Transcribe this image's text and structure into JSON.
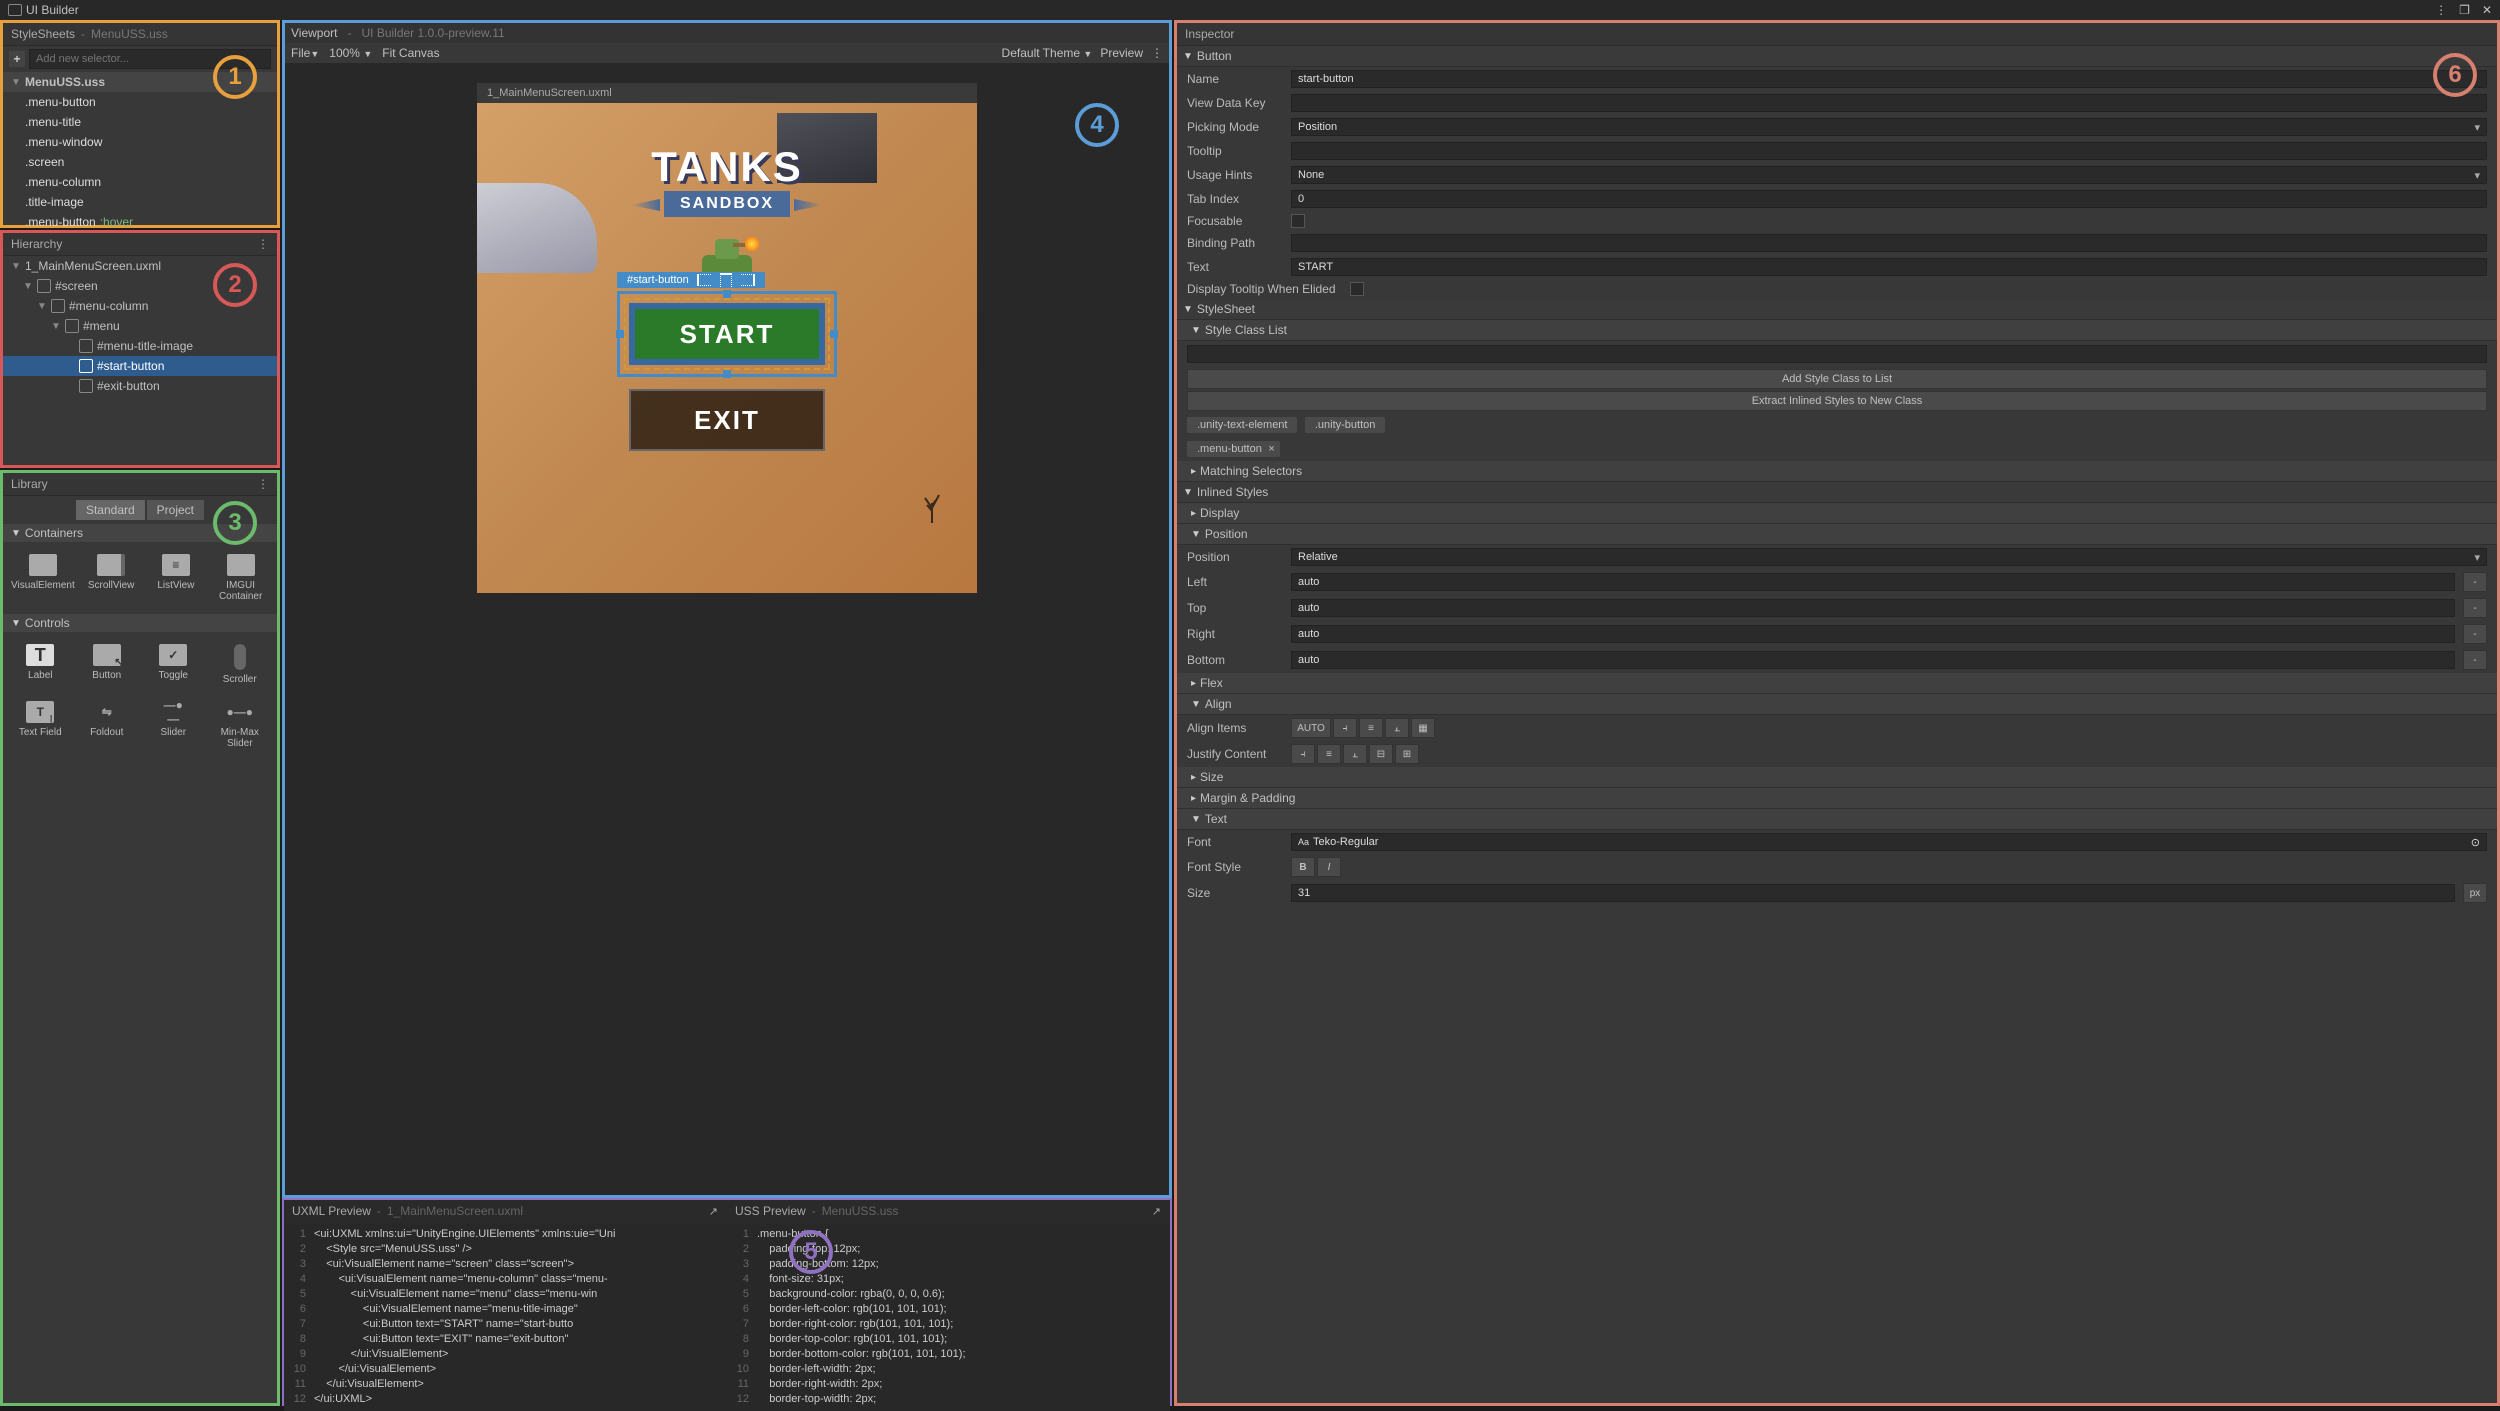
{
  "titlebar": {
    "title": "UI Builder"
  },
  "stylesheets": {
    "header": "StyleSheets",
    "file": "MenuUSS.uss",
    "placeholder": "Add new selector...",
    "tree_root": "MenuUSS.uss",
    "selectors": [
      ".menu-button",
      ".menu-title",
      ".menu-window",
      ".screen",
      ".menu-column",
      ".title-image"
    ],
    "hover_selector": ".menu-button",
    "hover_state": ":hover"
  },
  "hierarchy": {
    "header": "Hierarchy",
    "root": "1_MainMenuScreen.uxml",
    "nodes": {
      "screen": "#screen",
      "menu_column": "#menu-column",
      "menu": "#menu",
      "title_image": "#menu-title-image",
      "start_button": "#start-button",
      "exit_button": "#exit-button"
    }
  },
  "library": {
    "header": "Library",
    "tabs": {
      "standard": "Standard",
      "project": "Project"
    },
    "containers_label": "Containers",
    "containers": [
      "VisualElement",
      "ScrollView",
      "ListView",
      "IMGUI Container"
    ],
    "controls_label": "Controls",
    "controls": [
      "Label",
      "Button",
      "Toggle",
      "Scroller",
      "Text Field",
      "Foldout",
      "Slider",
      "Min-Max Slider"
    ]
  },
  "viewport": {
    "header": "Viewport",
    "subtitle": "UI Builder 1.0.0-preview.11",
    "file_menu": "File",
    "zoom": "100%",
    "fit": "Fit Canvas",
    "theme": "Default Theme",
    "preview": "Preview",
    "canvas_tab": "1_MainMenuScreen.uxml",
    "logo_main": "TANKS",
    "logo_sub": "SANDBOX",
    "selected_label": "#start-button",
    "start_btn": "START",
    "exit_btn": "EXIT"
  },
  "uxml_preview": {
    "header": "UXML Preview",
    "file": "1_MainMenuScreen.uxml",
    "lines": [
      "<ui:UXML xmlns:ui=\"UnityEngine.UIElements\" xmlns:uie=\"Uni",
      "    <Style src=\"MenuUSS.uss\" />",
      "    <ui:VisualElement name=\"screen\" class=\"screen\">",
      "        <ui:VisualElement name=\"menu-column\" class=\"menu-",
      "            <ui:VisualElement name=\"menu\" class=\"menu-win",
      "                <ui:VisualElement name=\"menu-title-image\"",
      "                <ui:Button text=\"START\" name=\"start-butto",
      "                <ui:Button text=\"EXIT\" name=\"exit-button\"",
      "            </ui:VisualElement>",
      "        </ui:VisualElement>",
      "    </ui:VisualElement>",
      "</ui:UXML>"
    ]
  },
  "uss_preview": {
    "header": "USS Preview",
    "file": "MenuUSS.uss",
    "lines": [
      ".menu-button {",
      "    padding-top: 12px;",
      "    padding-bottom: 12px;",
      "    font-size: 31px;",
      "    background-color: rgba(0, 0, 0, 0.6);",
      "    border-left-color: rgb(101, 101, 101);",
      "    border-right-color: rgb(101, 101, 101);",
      "    border-top-color: rgb(101, 101, 101);",
      "    border-bottom-color: rgb(101, 101, 101);",
      "    border-left-width: 2px;",
      "    border-right-width: 2px;",
      "    border-top-width: 2px;"
    ]
  },
  "inspector": {
    "header": "Inspector",
    "type": "Button",
    "fields": {
      "Name": "start-button",
      "ViewDataKey": "View Data Key",
      "PickingMode": "Picking Mode",
      "PickingModeVal": "Position",
      "Tooltip": "Tooltip",
      "UsageHints": "Usage Hints",
      "UsageHintsVal": "None",
      "TabIndex": "Tab Index",
      "TabIndexVal": "0",
      "Focusable": "Focusable",
      "BindingPath": "Binding Path",
      "Text": "Text",
      "TextVal": "START",
      "DisplayTooltip": "Display Tooltip When Elided"
    },
    "sections": {
      "stylesheet": "StyleSheet",
      "style_class_list": "Style Class List",
      "add_class": "Add Style Class to List",
      "extract": "Extract Inlined Styles to New Class",
      "chips": [
        ".unity-text-element",
        ".unity-button",
        ".menu-button"
      ],
      "matching": "Matching Selectors",
      "inlined": "Inlined Styles",
      "display": "Display",
      "position": "Position",
      "flex": "Flex",
      "align": "Align",
      "size": "Size",
      "margin": "Margin & Padding",
      "text": "Text"
    },
    "position": {
      "label": "Position",
      "value": "Relative",
      "Left": "Left",
      "Top": "Top",
      "Right": "Right",
      "Bottom": "Bottom",
      "auto": "auto"
    },
    "align": {
      "items": "Align Items",
      "auto_btn": "AUTO",
      "justify": "Justify Content"
    },
    "text_section": {
      "font": "Font",
      "font_val": "Teko-Regular",
      "font_prefix": "Aa",
      "style": "Font Style",
      "bold": "B",
      "italic": "I",
      "size": "Size",
      "size_val": "31",
      "unit": "px"
    }
  }
}
